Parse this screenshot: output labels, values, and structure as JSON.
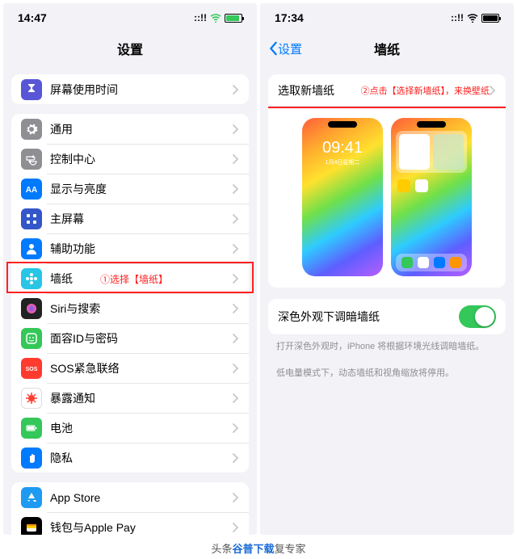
{
  "left": {
    "time": "14:47",
    "title": "设置",
    "annotation": "①选择【墙纸】",
    "groups": [
      [
        {
          "id": "screentime",
          "label": "屏幕使用时间",
          "color": "#5856d6",
          "icon": "hourglass"
        }
      ],
      [
        {
          "id": "general",
          "label": "通用",
          "color": "#8e8e93",
          "icon": "gear"
        },
        {
          "id": "control",
          "label": "控制中心",
          "color": "#8e8e93",
          "icon": "switches"
        },
        {
          "id": "display",
          "label": "显示与亮度",
          "color": "#007aff",
          "icon": "aa"
        },
        {
          "id": "home",
          "label": "主屏幕",
          "color": "#3356c9",
          "icon": "grid"
        },
        {
          "id": "access",
          "label": "辅助功能",
          "color": "#007aff",
          "icon": "person"
        },
        {
          "id": "wallpaper",
          "label": "墙纸",
          "color": "#29c5e6",
          "icon": "flower",
          "highlight": true
        },
        {
          "id": "siri",
          "label": "Siri与搜索",
          "color": "#222",
          "icon": "siri"
        },
        {
          "id": "faceid",
          "label": "面容ID与密码",
          "color": "#34c759",
          "icon": "face"
        },
        {
          "id": "sos",
          "label": "SOS紧急联络",
          "color": "#ff3b30",
          "icon": "sos"
        },
        {
          "id": "exposure",
          "label": "暴露通知",
          "color": "#fff",
          "icon": "virus",
          "iconColor": "#ff3b30",
          "border": true
        },
        {
          "id": "battery",
          "label": "电池",
          "color": "#34c759",
          "icon": "battery"
        },
        {
          "id": "privacy",
          "label": "隐私",
          "color": "#007aff",
          "icon": "hand"
        }
      ],
      [
        {
          "id": "appstore",
          "label": "App Store",
          "color": "#1e9bf0",
          "icon": "astore"
        },
        {
          "id": "wallet",
          "label": "钱包与Apple Pay",
          "color": "#000",
          "icon": "wallet"
        }
      ]
    ]
  },
  "right": {
    "time": "17:34",
    "back": "设置",
    "title": "墙纸",
    "choose": "选取新墙纸",
    "annotation": "②点击【选择新墙纸】，来换壁纸",
    "lockTime": "09:41",
    "lockDate": "1月4日星期二",
    "dim": "深色外观下调暗墙纸",
    "note1": "打开深色外观时，iPhone 将根据环境光线调暗墙纸。",
    "note2": "低电量模式下，动态墙纸和视角缩放将停用。"
  },
  "watermark": {
    "pre": "头条",
    "mid": "谷普下载",
    "post": "复专家"
  }
}
